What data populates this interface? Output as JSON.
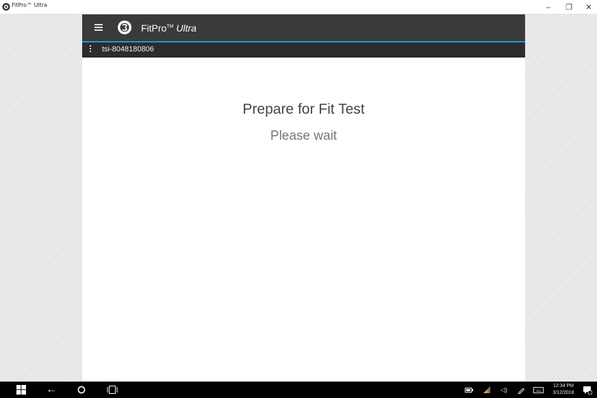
{
  "window": {
    "title": "FitPro™ Ultra",
    "minimize_glyph": "–",
    "maximize_glyph": "❐",
    "close_glyph": "✕"
  },
  "appbar": {
    "brand_name": "FitPro",
    "brand_tm": "TM",
    "brand_suffix": "Ultra",
    "accent_color": "#1e9bd7",
    "background_color": "#3a3a3a"
  },
  "device": {
    "id": "tsi-8048180806"
  },
  "main": {
    "heading": "Prepare for Fit Test",
    "subheading": "Please wait"
  },
  "taskbar": {
    "back_glyph": "←",
    "volume_glyph": "◁)",
    "time": "12:34 PM",
    "date": "3/12/2018",
    "icons": [
      "windows-start-icon",
      "back-arrow-icon",
      "cortana-icon",
      "task-view-icon",
      "battery-icon",
      "wifi-icon",
      "volume-icon",
      "pen-icon",
      "touch-keyboard-icon",
      "notification-icon"
    ]
  }
}
